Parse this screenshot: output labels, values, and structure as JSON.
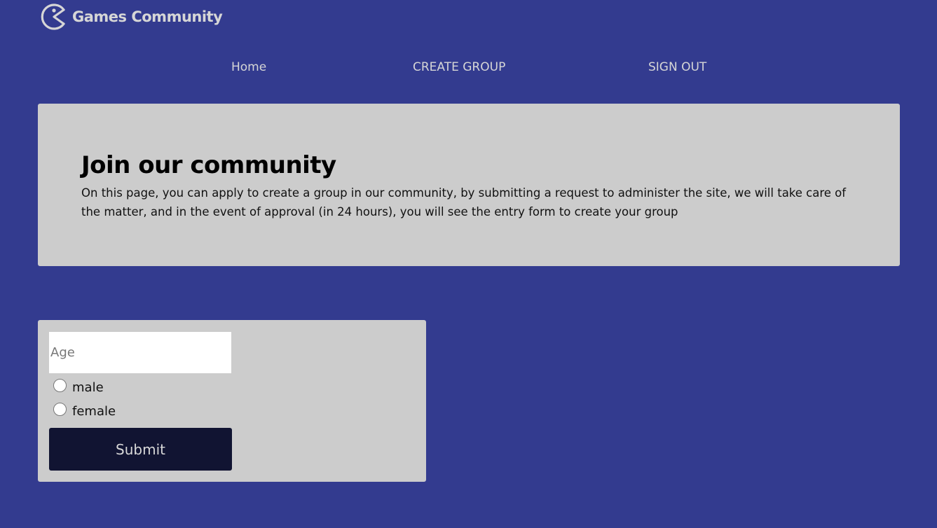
{
  "brand": {
    "name": "Games Community",
    "icon": "pacman-logo-icon"
  },
  "nav": {
    "home": "Home",
    "create_group": "CREATE GROUP",
    "sign_out": "SIGN OUT"
  },
  "hero": {
    "title": "Join our community",
    "text": "On this page, you can apply to create a group in our community, by submitting a request to administer the site, we will take care of the matter, and in the event of approval (in 24 hours), you will see the entry form to create your group"
  },
  "form": {
    "age_placeholder": "Age",
    "age_value": "",
    "gender_options": [
      "male",
      "female"
    ],
    "submit_label": "Submit"
  },
  "colors": {
    "page_bg": "#333b8f",
    "card_bg": "#cccccc",
    "button_bg": "#111432",
    "nav_text": "#d6d6d6"
  }
}
